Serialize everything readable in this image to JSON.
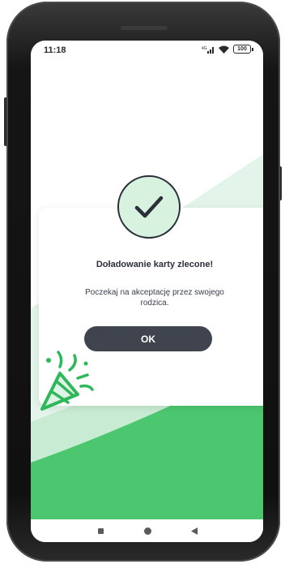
{
  "status_bar": {
    "time": "11:18",
    "battery": "100"
  },
  "dialog": {
    "title": "Doładowanie karty zlecone!",
    "message": "Poczekaj na akceptację przez swojego rodzica.",
    "ok_label": "OK"
  },
  "colors": {
    "accent_green": "#4cc76f",
    "light_green": "#dff3e6",
    "dark_button": "#3f444f"
  },
  "icons": {
    "success": "check-circle-icon",
    "decoration": "party-popper-icon",
    "nav": [
      "recent-apps-icon",
      "home-icon",
      "back-icon"
    ]
  }
}
